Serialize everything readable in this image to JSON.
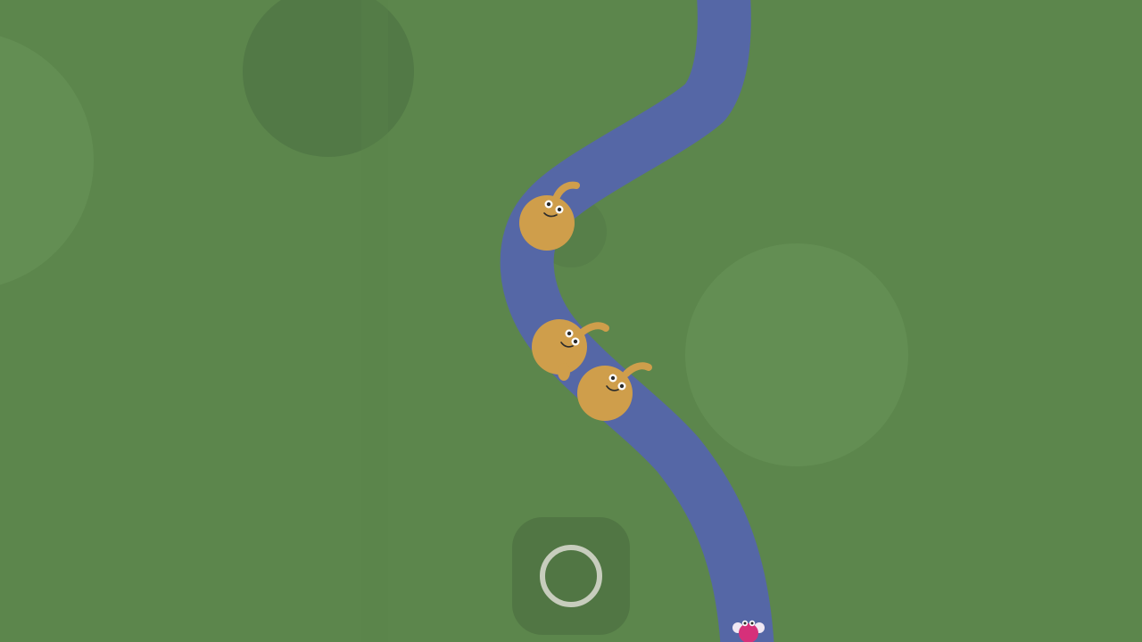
{
  "game": {
    "colors": {
      "grass": "#5c864c",
      "grass_light_patch": "#6a955a",
      "grass_dark_patch": "#517846",
      "river": "#5567a6",
      "creature_body": "#cf9e4b",
      "creature_eye": "#ffffff",
      "creature_pupil": "#2b2b2b",
      "small_creature_body": "#d6307a",
      "small_creature_ear": "#f1e8f3",
      "button_background": "#486a3e",
      "button_ring": "#c7cdbd"
    },
    "creatures": [
      {
        "kind": "tan-blob-creature",
        "name": "creature-1"
      },
      {
        "kind": "tan-blob-creature",
        "name": "creature-2"
      },
      {
        "kind": "tan-blob-creature",
        "name": "creature-3"
      }
    ],
    "player": {
      "kind": "pink-small-creature"
    },
    "action_button": {
      "icon": "circle-ring-icon"
    }
  }
}
